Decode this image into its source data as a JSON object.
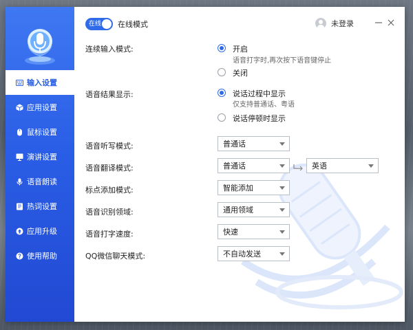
{
  "sidebar": {
    "items": [
      {
        "label": "输入设置",
        "icon": "keyboard-icon",
        "active": true
      },
      {
        "label": "应用设置",
        "icon": "cube-icon",
        "active": false
      },
      {
        "label": "鼠标设置",
        "icon": "mouse-icon",
        "active": false
      },
      {
        "label": "演讲设置",
        "icon": "slides-icon",
        "active": false
      },
      {
        "label": "语音朗读",
        "icon": "microphone-icon",
        "active": false
      },
      {
        "label": "热词设置",
        "icon": "book-icon",
        "active": false
      },
      {
        "label": "应用升级",
        "icon": "upgrade-icon",
        "active": false
      },
      {
        "label": "使用帮助",
        "icon": "help-icon",
        "active": false
      }
    ]
  },
  "header": {
    "toggle_label": "在线",
    "mode_label": "在线模式",
    "user_label": "未登录"
  },
  "settings": {
    "continuous_input": {
      "label": "连续输入模式:",
      "options": [
        {
          "label": "开启",
          "sub": "语音打字时,再次按下语音键停止",
          "checked": true
        },
        {
          "label": "关闭",
          "sub": "",
          "checked": false
        }
      ]
    },
    "result_display": {
      "label": "语音结果显示:",
      "options": [
        {
          "label": "说话过程中显示",
          "sub": "仅支持普通话、粤语",
          "checked": true
        },
        {
          "label": "说话停顿时显示",
          "sub": "",
          "checked": false
        }
      ]
    },
    "dictation_mode": {
      "label": "语音听写模式:",
      "value": "普通话"
    },
    "translation_mode": {
      "label": "语音翻译模式:",
      "from": "普通话",
      "to": "英语"
    },
    "punctuation_mode": {
      "label": "标点添加模式:",
      "value": "智能添加"
    },
    "recognition_domain": {
      "label": "语音识别领域:",
      "value": "通用领域"
    },
    "typing_speed": {
      "label": "语音打字速度:",
      "value": "快速"
    },
    "qq_wechat_mode": {
      "label": "QQ微信聊天模式:",
      "value": "不自动发送"
    }
  },
  "colors": {
    "accent": "#2f6be8",
    "sidebar_top": "#3f78f2",
    "sidebar_bottom": "#2249d3"
  }
}
